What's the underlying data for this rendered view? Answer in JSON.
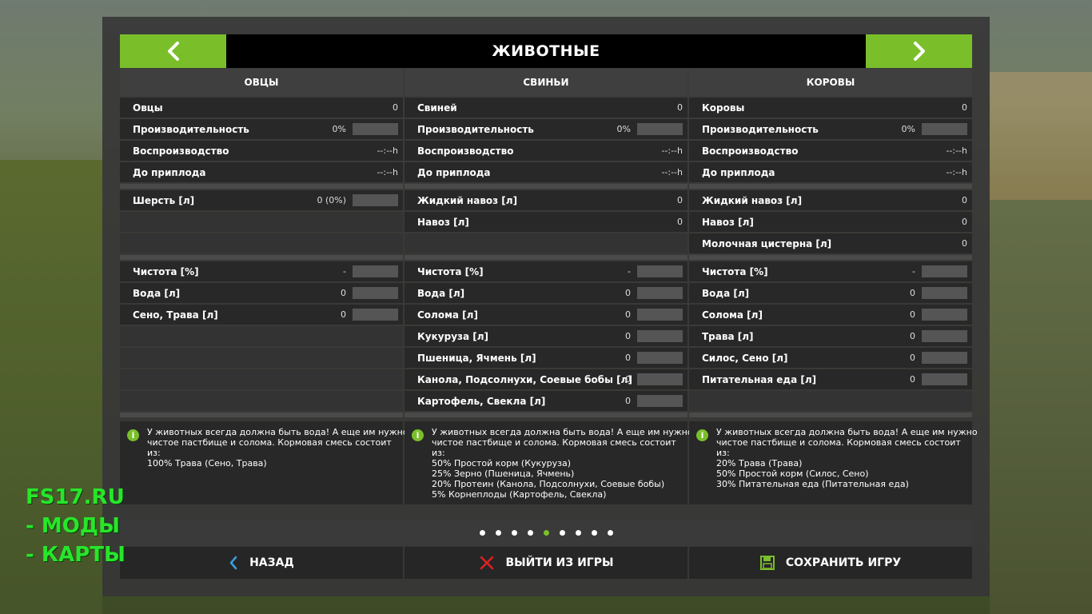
{
  "title": "ЖИВОТНЫЕ",
  "accent_color": "#7abf2a",
  "icons": {
    "prev": "chevron-left-icon",
    "next": "chevron-right-icon",
    "back": "chevron-left-icon",
    "quit": "close-icon",
    "save": "floppy-disk-icon",
    "info": "info-icon"
  },
  "columns": [
    {
      "header": "ОВЦЫ",
      "rows": [
        {
          "label": "Овцы",
          "value": "0",
          "bar": false
        },
        {
          "label": "Производительность",
          "value": "0%",
          "bar": true
        },
        {
          "label": "Воспроизводство",
          "value": "--:--h",
          "bar": false
        },
        {
          "label": "До приплода",
          "value": "--:--h",
          "bar": false
        }
      ],
      "products": [
        {
          "label": "Шерсть [л]",
          "value": "0 (0%)",
          "bar": true
        },
        {
          "label": "",
          "value": "",
          "bar": false
        },
        {
          "label": "",
          "value": "",
          "bar": false
        }
      ],
      "needs": [
        {
          "label": "Чистота [%]",
          "value": "-",
          "bar": true
        },
        {
          "label": "Вода [л]",
          "value": "0",
          "bar": true
        },
        {
          "label": "Сено, Трава [л]",
          "value": "0",
          "bar": true
        },
        {
          "label": "",
          "value": "",
          "bar": false
        },
        {
          "label": "",
          "value": "",
          "bar": false
        },
        {
          "label": "",
          "value": "",
          "bar": false
        },
        {
          "label": "",
          "value": "",
          "bar": false
        }
      ],
      "info": [
        "У животных всегда должна быть вода! А еще им нужно",
        "чистое пастбище и солома. Кормовая смесь состоит",
        "из:",
        "100% Трава (Сено, Трава)"
      ]
    },
    {
      "header": "СВИНЬИ",
      "rows": [
        {
          "label": "Свиней",
          "value": "0",
          "bar": false
        },
        {
          "label": "Производительность",
          "value": "0%",
          "bar": true
        },
        {
          "label": "Воспроизводство",
          "value": "--:--h",
          "bar": false
        },
        {
          "label": "До приплода",
          "value": "--:--h",
          "bar": false
        }
      ],
      "products": [
        {
          "label": "Жидкий навоз [л]",
          "value": "0",
          "bar": false
        },
        {
          "label": "Навоз [л]",
          "value": "0",
          "bar": false
        },
        {
          "label": "",
          "value": "",
          "bar": false
        }
      ],
      "needs": [
        {
          "label": "Чистота [%]",
          "value": "-",
          "bar": true
        },
        {
          "label": "Вода [л]",
          "value": "0",
          "bar": true
        },
        {
          "label": "Солома [л]",
          "value": "0",
          "bar": true
        },
        {
          "label": "Кукуруза [л]",
          "value": "0",
          "bar": true
        },
        {
          "label": "Пшеница, Ячмень [л]",
          "value": "0",
          "bar": true
        },
        {
          "label": "Канола, Подсолнухи, Соевые бобы [л]",
          "value": "0",
          "bar": true
        },
        {
          "label": "Картофель, Свекла [л]",
          "value": "0",
          "bar": true
        }
      ],
      "info": [
        "У животных всегда должна быть вода! А еще им нужно",
        "чистое пастбище и солома. Кормовая смесь состоит",
        "из:",
        "50% Простой корм (Кукуруза)",
        "25% Зерно (Пшеница, Ячмень)",
        "20% Протеин (Канола, Подсолнухи, Соевые бобы)",
        "5% Корнеплоды (Картофель, Свекла)"
      ]
    },
    {
      "header": "КОРОВЫ",
      "rows": [
        {
          "label": "Коровы",
          "value": "0",
          "bar": false
        },
        {
          "label": "Производительность",
          "value": "0%",
          "bar": true
        },
        {
          "label": "Воспроизводство",
          "value": "--:--h",
          "bar": false
        },
        {
          "label": "До приплода",
          "value": "--:--h",
          "bar": false
        }
      ],
      "products": [
        {
          "label": "Жидкий навоз [л]",
          "value": "0",
          "bar": false
        },
        {
          "label": "Навоз [л]",
          "value": "0",
          "bar": false
        },
        {
          "label": "Молочная цистерна [л]",
          "value": "0",
          "bar": false
        }
      ],
      "needs": [
        {
          "label": "Чистота [%]",
          "value": "-",
          "bar": true
        },
        {
          "label": "Вода [л]",
          "value": "0",
          "bar": true
        },
        {
          "label": "Солома [л]",
          "value": "0",
          "bar": true
        },
        {
          "label": "Трава [л]",
          "value": "0",
          "bar": true
        },
        {
          "label": "Силос, Сено [л]",
          "value": "0",
          "bar": true
        },
        {
          "label": "Питательная еда [л]",
          "value": "0",
          "bar": true
        },
        {
          "label": "",
          "value": "",
          "bar": false
        }
      ],
      "info": [
        "У животных всегда должна быть вода! А еще им нужно",
        "чистое пастбище и солома. Кормовая смесь состоит",
        "из:",
        "20% Трава (Трава)",
        "50% Простой корм (Силос, Сено)",
        "30% Питательная еда (Питательная еда)"
      ]
    }
  ],
  "pagination": {
    "total": 9,
    "active_index": 4
  },
  "buttons": {
    "back": "НАЗАД",
    "quit": "ВЫЙТИ ИЗ ИГРЫ",
    "save": "СОХРАНИТЬ ИГРУ"
  },
  "watermark": [
    "FS17.RU",
    "- МОДЫ",
    "- КАРТЫ"
  ]
}
